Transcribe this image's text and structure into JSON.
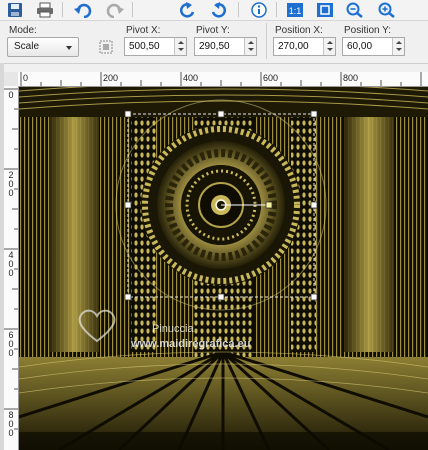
{
  "toolbar": {
    "buttons": [
      {
        "name": "save-icon",
        "glyph": "save-icon"
      },
      {
        "name": "print-icon",
        "glyph": "print-icon"
      },
      {
        "name": "undo-icon",
        "glyph": "undo-icon"
      },
      {
        "name": "redo-icon",
        "glyph": "redo-icon"
      },
      {
        "name": "rotate-left-icon",
        "glyph": "rotate-left-icon"
      },
      {
        "name": "rotate-right-icon",
        "glyph": "rotate-right-icon"
      },
      {
        "name": "info-icon",
        "glyph": "info-icon"
      },
      {
        "name": "actual-size-icon",
        "glyph": "actual-size-icon"
      },
      {
        "name": "fit-window-icon",
        "glyph": "fit-window-icon"
      },
      {
        "name": "zoom-out-icon",
        "glyph": "zoom-out-icon"
      },
      {
        "name": "zoom-in-icon",
        "glyph": "zoom-in-icon"
      }
    ]
  },
  "controls": {
    "mode_label": "Mode:",
    "mode_value": "Scale",
    "pivot_x_label": "Pivot X:",
    "pivot_x_value": "500,50",
    "pivot_y_label": "Pivot Y:",
    "pivot_y_value": "290,50",
    "position_x_label": "Position X:",
    "position_x_value": "270,00",
    "position_y_label": "Position Y:",
    "position_y_value": "60,00"
  },
  "ruler": {
    "horizontal": [
      "0",
      "200",
      "400",
      "600",
      "800"
    ],
    "vertical": [
      "0",
      "200",
      "400",
      "600",
      "800"
    ]
  },
  "canvas": {
    "watermark_name": "Pinuccia",
    "watermark_url": "www.maidiregrafica.eu"
  },
  "colors": {
    "gold": "#c9b85a",
    "dark": "#1a1606",
    "accent_blue": "#1e6fd0"
  }
}
